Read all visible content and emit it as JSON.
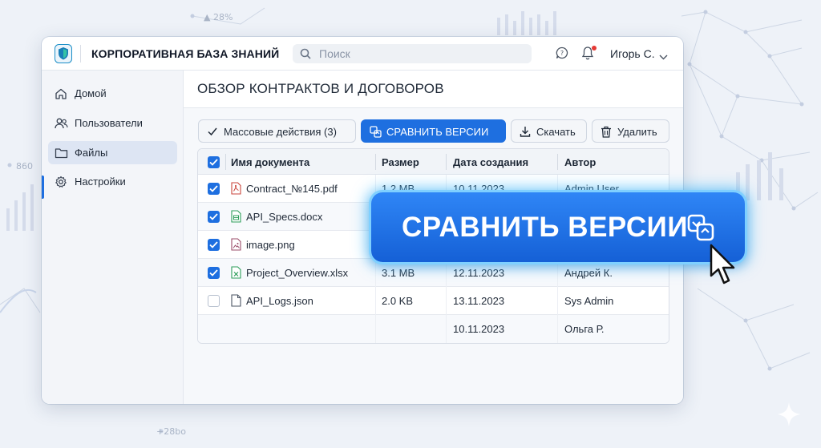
{
  "app": {
    "title": "КОРПОРАТИВНАЯ БАЗА ЗНАНИЙ",
    "logo_icon": "shield-icon"
  },
  "search": {
    "placeholder": "Поиск"
  },
  "header": {
    "user_name": "Игорь С.",
    "notification_dot_color": "#e53935"
  },
  "sidebar": {
    "items": [
      {
        "label": "Домой",
        "icon": "home-icon",
        "active": false
      },
      {
        "label": "Пользователи",
        "icon": "users-icon",
        "active": false
      },
      {
        "label": "Файлы",
        "icon": "folder-icon",
        "active": true
      },
      {
        "label": "Настройки",
        "icon": "gear-icon",
        "active": false
      }
    ]
  },
  "page": {
    "title": "ОБЗОР КОНТРАКТОВ И ДОГОВОРОВ"
  },
  "toolbar": {
    "bulk_actions": "Массовые действия (3)",
    "compare_versions": "СРАВНИТЬ ВЕРСИИ",
    "download": "Скачать",
    "delete": "Удалить"
  },
  "table": {
    "columns": [
      "Имя документа",
      "Размер",
      "Дата создания",
      "Автор"
    ],
    "header_checked": true,
    "rows": [
      {
        "checked": true,
        "icon": "pdf-file-icon",
        "name": "Contract_№145.pdf",
        "size": "1.2 MB",
        "date": "10.11.2023",
        "author": "Admin User"
      },
      {
        "checked": true,
        "icon": "doc-file-icon",
        "name": "API_Specs.docx",
        "size": "",
        "date": "",
        "author": ""
      },
      {
        "checked": true,
        "icon": "image-file-icon",
        "name": "image.png",
        "size": "",
        "date": "",
        "author": ""
      },
      {
        "checked": true,
        "icon": "xlsx-file-icon",
        "name": "Project_Overview.xlsx",
        "size": "3.1 MB",
        "date": "12.11.2023",
        "author": "Андрей К."
      },
      {
        "checked": false,
        "icon": "file-icon",
        "name": "API_Logs.json",
        "size": "2.0 KB",
        "date": "13.11.2023",
        "author": "Sys Admin"
      },
      {
        "checked": null,
        "icon": "",
        "name": "",
        "size": "",
        "date": "10.11.2023",
        "author": "Ольга Р."
      }
    ]
  },
  "callout": {
    "label": "СРАВНИТЬ ВЕРСИИ",
    "icon": "compare-icon"
  },
  "background": {
    "stat_a": "▲ 28%",
    "stat_b": "860",
    "stat_c": "+28bo"
  },
  "colors": {
    "accent": "#1e6fe0",
    "glow": "#7fd0ff"
  }
}
